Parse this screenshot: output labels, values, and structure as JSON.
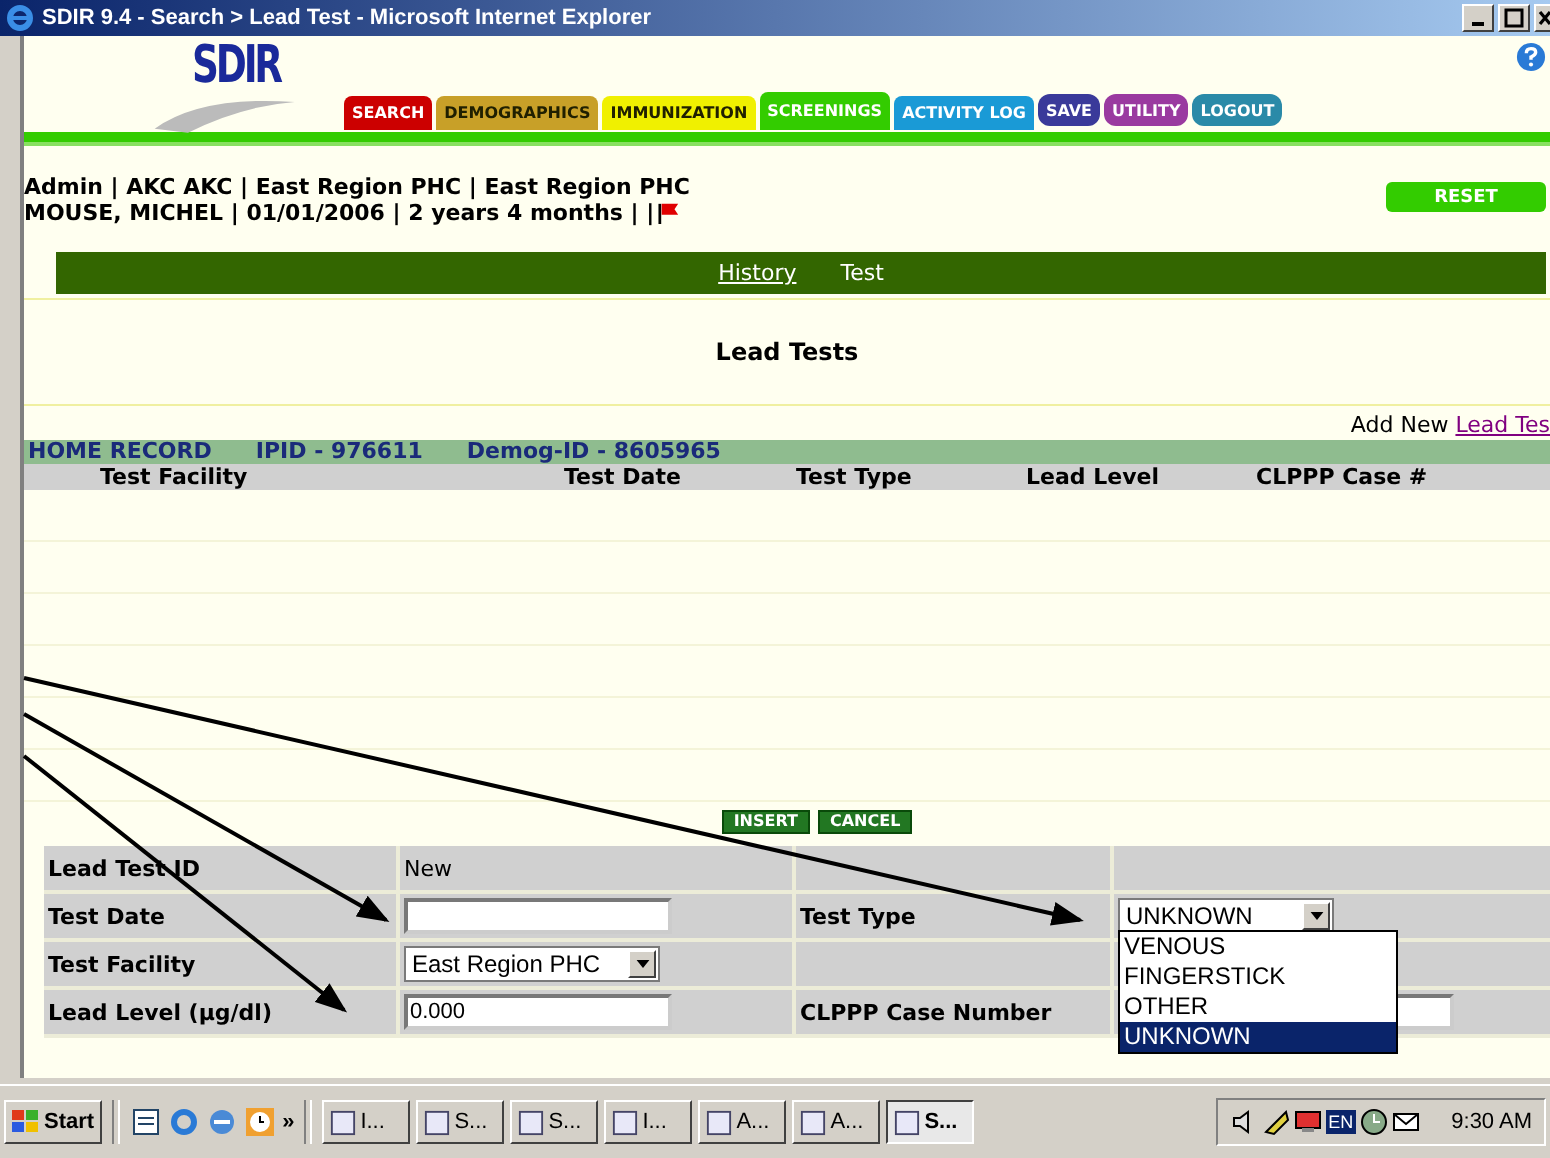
{
  "window": {
    "title": "SDIR 9.4 - Search > Lead Test - Microsoft Internet Explorer"
  },
  "logo": {
    "text": "SDIR"
  },
  "tabs": [
    {
      "label": "SEARCH",
      "color": "#cc0000",
      "selected": false
    },
    {
      "label": "DEMOGRAPHICS",
      "color": "#c8a028",
      "selected": false
    },
    {
      "label": "IMMUNIZATION",
      "color": "#f0f000",
      "selected": false
    },
    {
      "label": "SCREENINGS",
      "color": "#33cc00",
      "selected": true
    },
    {
      "label": "ACTIVITY LOG",
      "color": "#1a9ad6",
      "selected": false
    }
  ],
  "actions": [
    {
      "label": "SAVE",
      "color": "#3a3a9a"
    },
    {
      "label": "UTILITY",
      "color": "#9a3aa0"
    },
    {
      "label": "LOGOUT",
      "color": "#2a8aa8"
    }
  ],
  "context": {
    "line1": "Admin | AKC AKC | East Region PHC | East Region PHC",
    "line2": "MOUSE, MICHEL | 01/01/2006 | 2 years 4 months | |",
    "flagged": true
  },
  "reset_button": "RESET",
  "subnav": [
    {
      "label": "History",
      "selected": false
    },
    {
      "label": "Test",
      "selected": true
    }
  ],
  "heading": "Lead Tests",
  "add_new": {
    "prefix": "Add New",
    "link": "Lead Tes"
  },
  "record_bar": [
    "HOME RECORD",
    "IPID - 976611",
    "Demog-ID - 8605965"
  ],
  "table": {
    "columns": [
      "Test Facility",
      "Test Date",
      "Test Type",
      "Lead Level",
      "CLPPP Case #"
    ]
  },
  "buttons": [
    "INSERT",
    "CANCEL"
  ],
  "form": {
    "id_label": "Lead Test ID",
    "id_value": "New",
    "date_label": "Test Date",
    "type_label": "Test Type",
    "type_value": "UNKNOWN",
    "type_expanded": true,
    "type_options": [
      {
        "label": "VENOUS",
        "selected": false
      },
      {
        "label": "FINGERSTICK",
        "selected": false
      },
      {
        "label": "OTHER",
        "selected": false
      },
      {
        "label": "UNKNOWN",
        "selected": true
      }
    ],
    "facility_label": "Test Facility",
    "facility_value": "East Region PHC",
    "level_label": "Lead Level (µg/dl)",
    "level_value": "0.000",
    "case_label": "CLPPP Case Number"
  },
  "taskbar": {
    "start": "Start",
    "more": "»",
    "tasks": [
      {
        "label": "I...",
        "selected": false
      },
      {
        "label": "S...",
        "selected": false
      },
      {
        "label": "S...",
        "selected": false
      },
      {
        "label": "I...",
        "selected": false
      },
      {
        "label": "A...",
        "selected": false
      },
      {
        "label": "A...",
        "selected": false
      },
      {
        "label": "S...",
        "selected": true
      }
    ],
    "tray_lang": "EN",
    "clock": "9:30 AM"
  }
}
